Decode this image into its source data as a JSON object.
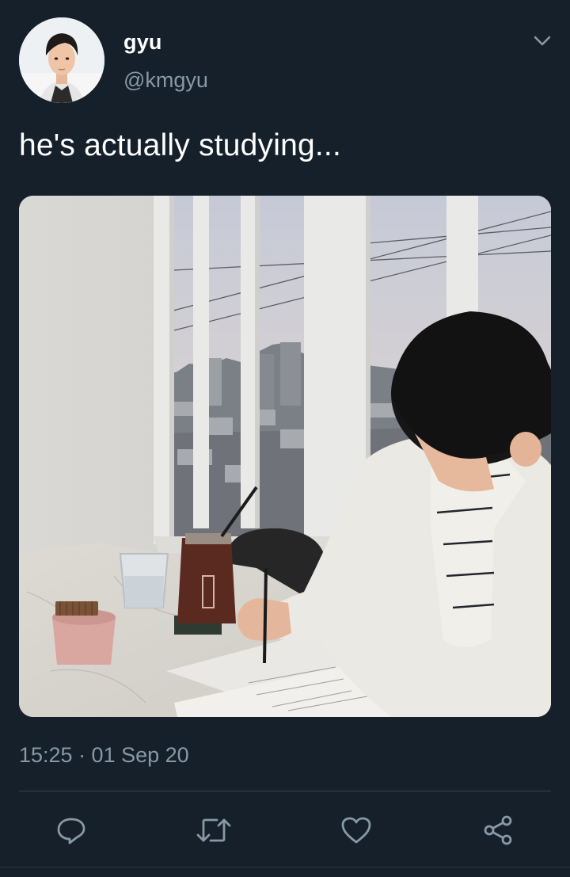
{
  "author": {
    "display_name": "gyu",
    "handle": "@kmgyu",
    "avatar": "profile-photo"
  },
  "tweet": {
    "text": "he's actually studying...",
    "media": "photo",
    "timestamp": "15:25 · 01 Sep 20"
  },
  "actions": {
    "reply": "reply-icon",
    "retweet": "retweet-icon",
    "like": "heart-icon",
    "share": "share-icon"
  },
  "colors": {
    "background": "#15202b",
    "secondary_text": "#8899a6",
    "divider": "#38444d"
  }
}
